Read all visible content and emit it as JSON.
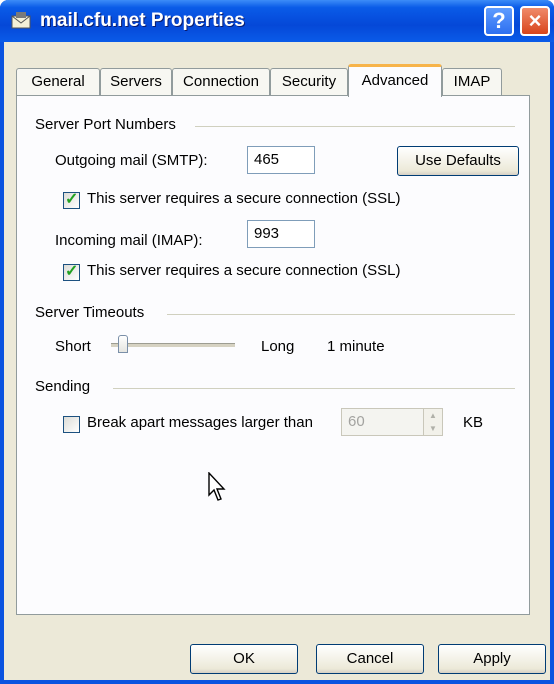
{
  "window": {
    "title": "mail.cfu.net Properties",
    "help_symbol": "?",
    "close_symbol": "×"
  },
  "tabs": [
    "General",
    "Servers",
    "Connection",
    "Security",
    "Advanced",
    "IMAP"
  ],
  "active_tab": "Advanced",
  "server_ports": {
    "group_label": "Server Port Numbers",
    "outgoing_label": "Outgoing mail (SMTP):",
    "outgoing_value": "465",
    "use_defaults_label": "Use Defaults",
    "outgoing_ssl_label": "This server requires a secure connection (SSL)",
    "outgoing_ssl_checked": true,
    "incoming_label": "Incoming mail (IMAP):",
    "incoming_value": "993",
    "incoming_ssl_label": "This server requires a secure connection (SSL)",
    "incoming_ssl_checked": true
  },
  "timeouts": {
    "group_label": "Server Timeouts",
    "short_label": "Short",
    "long_label": "Long",
    "value_text": "1 minute",
    "slider_level": 0.1
  },
  "sending": {
    "group_label": "Sending",
    "break_apart_label": "Break apart messages larger than",
    "break_apart_checked": false,
    "size_value": "60",
    "unit_label": "KB"
  },
  "buttons": {
    "ok": "OK",
    "cancel": "Cancel",
    "apply": "Apply"
  },
  "icons": {
    "title": "envelope-icon",
    "cursor": "mouse-cursor-icon"
  },
  "colors": {
    "titlebar": "#0a5be8",
    "dialog_bg": "#ece9d8",
    "active_tab_accent": "#f7b44a",
    "check": "#21a121"
  }
}
